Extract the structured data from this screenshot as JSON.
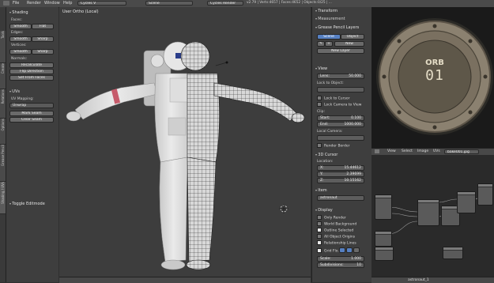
{
  "header": {
    "menu": [
      "File",
      "Render",
      "Window",
      "Help"
    ],
    "layout": "Cycles V",
    "scene": "Scene",
    "engine": "Cycles Render",
    "stats": "v2.79 | Verts:4657 | Faces:4652 | Objects:0/25 | ..."
  },
  "tabs": [
    "Tools",
    "Create",
    "Relations",
    "Options",
    "Grease Pencil",
    "Shading / UVs"
  ],
  "tools": {
    "shading_title": "Shading",
    "faces_label": "Faces:",
    "edges_label": "Edges:",
    "vertices_label": "Vertices:",
    "smooth": "Smooth",
    "flat": "Flat",
    "sharp": "Sharp",
    "normals_label": "Normals:",
    "recalculate": "Recalculate",
    "flip_direction": "Flip Direction",
    "set_from_faces": "Set From Faces",
    "uvs_title": "UVs",
    "uv_mapping_label": "UV Mapping:",
    "unwrap": "Unwrap",
    "mark_seam": "Mark Seam",
    "clear_seam": "Clear Seam",
    "toggle_editmode": "Toggle Editmode"
  },
  "viewport": {
    "label": "User Ortho (Local)"
  },
  "npanel": {
    "transform_title": "Transform",
    "measure_title": "Measurement",
    "grease_pencil_title": "Grease Pencil Layers",
    "scene_btn": "Scene",
    "object_btn": "Object",
    "new_btn": "New",
    "new_layer_btn": "New Layer",
    "view_title": "View",
    "lens_label": "Lens:",
    "lens_value": "50.000",
    "lock_to_object": "Lock to Object:",
    "lock_to_cursor": "Lock to Cursor",
    "lock_camera_to_view": "Lock Camera to View",
    "clip_label": "Clip:",
    "start_label": "Start:",
    "start_value": "0.100",
    "end_label": "End:",
    "end_value": "1000.000",
    "local_camera": "Local Camera:",
    "render_border": "Render Border",
    "cursor_title": "3D Cursor",
    "location_label": "Location:",
    "cx_label": "X:",
    "cx_value": "15.44612",
    "cy_label": "Y:",
    "cy_value": "2.39699",
    "cz_label": "Z:",
    "cz_value": "10.15162",
    "item_title": "Item",
    "item_name": "astronaut",
    "display_title": "Display",
    "only_render": "Only Render",
    "world_background": "World Background",
    "outline_selected": "Outline Selected",
    "all_object_origins": "All Object Origins",
    "relationship_lines": "Relationship Lines",
    "grid_floor": "Grid Flo...",
    "scale_label": "Scale:",
    "scale_value": "1.000",
    "subdivisions_label": "Subdivisions:",
    "subdivisions_value": "10"
  },
  "image_editor": {
    "logo_line1": "ORB",
    "logo_line2": "01",
    "menu": [
      "View",
      "Select",
      "Image",
      "UVs"
    ],
    "image_name": "bake001.jpg"
  },
  "node_editor": {
    "footer_label": "astronaut_1"
  },
  "colors": {
    "ui_bg": "#3e3e3e",
    "viewport_bg": "#3d3d3d",
    "accent_blue": "#5680c2",
    "porthole_gold": "#b49a62"
  }
}
